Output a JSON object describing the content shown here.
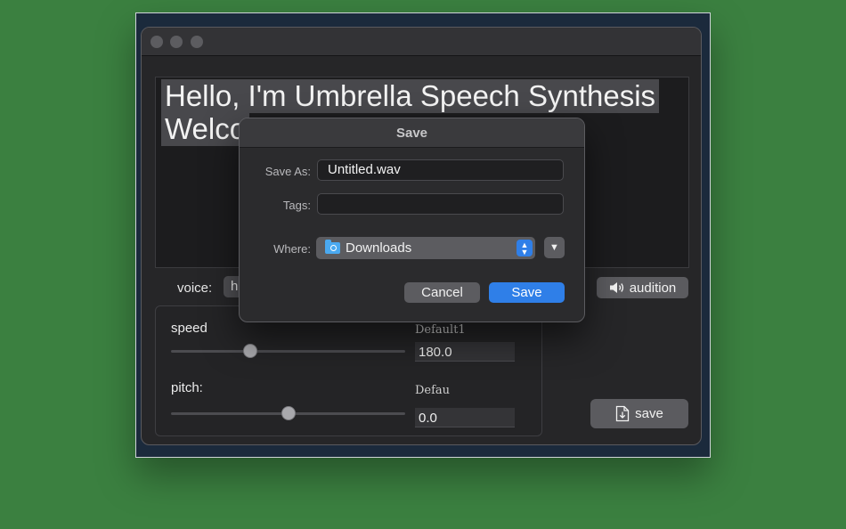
{
  "editor": {
    "line1": "Hello, I'm Umbrella Speech Synthesis",
    "line2": "Welco"
  },
  "voice": {
    "label": "voice:",
    "selected": "h"
  },
  "audition_label": "audition",
  "speed": {
    "label": "speed",
    "default_label": "Default1",
    "value": "180.0",
    "slider_fraction": 0.34
  },
  "pitch": {
    "label": "pitch:",
    "default_label": "Defau",
    "value": "0.0",
    "slider_fraction": 0.5
  },
  "save_main_label": "save",
  "dialog": {
    "title": "Save",
    "save_as_label": "Save As:",
    "save_as_value": "Untitled.wav",
    "tags_label": "Tags:",
    "tags_value": "",
    "where_label": "Where:",
    "where_value": "Downloads",
    "cancel_label": "Cancel",
    "save_label": "Save"
  },
  "colors": {
    "background": "#3b8040",
    "accent": "#2f7fe8"
  }
}
